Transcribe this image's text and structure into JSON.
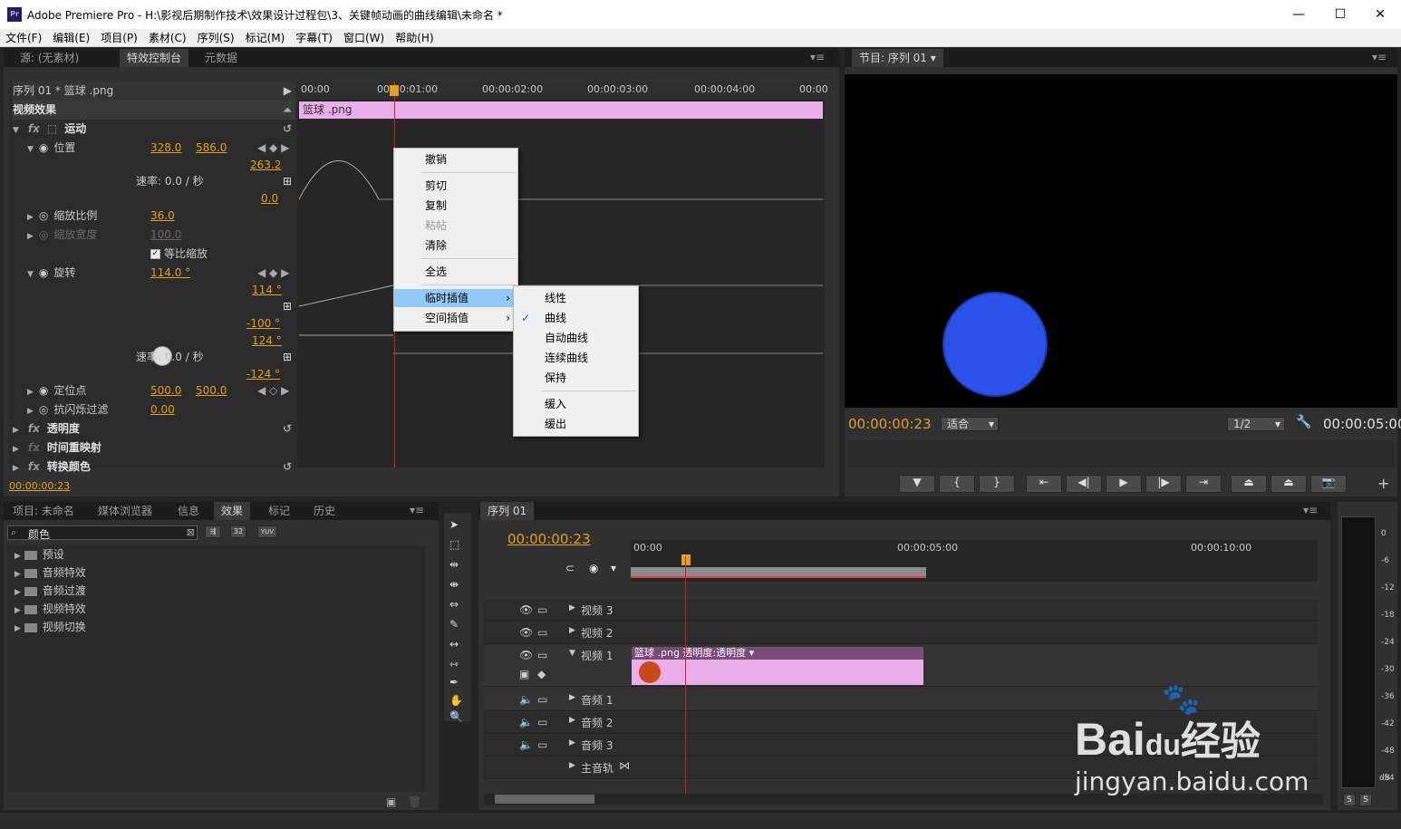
{
  "window": {
    "title": "Adobe Premiere Pro - H:\\影视后期制作技术\\效果设计过程包\\3、关键帧动画的曲线编辑\\未命名 *",
    "logo": "Pr"
  },
  "menu": [
    "文件(F)",
    "编辑(E)",
    "项目(P)",
    "素材(C)",
    "序列(S)",
    "标记(M)",
    "字幕(T)",
    "窗口(W)",
    "帮助(H)"
  ],
  "source_tabs": [
    "源: (无素材)",
    "特效控制台",
    "元数据"
  ],
  "effect_controls": {
    "clip": "序列 01 * 篮球 .png",
    "clip_bar": "篮球 .png",
    "ruler": [
      "00:00",
      "00:00:01:00",
      "00:00:02:00",
      "00:00:03:00",
      "00:00:04:00",
      "00:00"
    ],
    "video_effects": "视频效果",
    "motion": "运动",
    "position": {
      "label": "位置",
      "x": "328.0",
      "y": "586.0"
    },
    "pos_max": "263.2",
    "pos_min": "0.0",
    "speed": "速率: 0.0 / 秒",
    "scale": {
      "label": "缩放比例",
      "value": "36.0"
    },
    "scale_width": {
      "label": "缩放宽度",
      "value": "100.0"
    },
    "uniform_scale": "等比缩放",
    "rotation": {
      "label": "旋转",
      "value": "114.0 °"
    },
    "rot_max": "114 °",
    "rot_min": "-100 °",
    "rot_vmax": "124 °",
    "rot_vmin": "-124 °",
    "rot_speed": "速率: 0.0 / 秒",
    "anchor": {
      "label": "定位点",
      "x": "500.0",
      "y": "500.0"
    },
    "flicker": {
      "label": "抗闪烁过滤",
      "value": "0.00"
    },
    "opacity": "透明度",
    "time_remap": "时间重映射",
    "color_replace": "转换颜色",
    "timecode": "00:00:00:23"
  },
  "context_menu": {
    "items": [
      "撤销",
      "剪切",
      "复制",
      "粘帖",
      "清除",
      "全选",
      "临时插值",
      "空间插值"
    ]
  },
  "submenu": {
    "items": [
      "线性",
      "曲线",
      "自动曲线",
      "连续曲线",
      "保持",
      "缓入",
      "缓出"
    ],
    "checked": "曲线"
  },
  "program": {
    "tab": "节目: 序列 01",
    "timecode": "00:00:00:23",
    "fit": "适合",
    "quality": "1/2",
    "duration": "00:00:05:00",
    "ball_color": "#2a52e8"
  },
  "project_tabs": [
    "项目: 未命名",
    "媒体浏览器",
    "信息",
    "效果",
    "标记",
    "历史"
  ],
  "effects_panel": {
    "search": "颜色",
    "folders": [
      "预设",
      "音频特效",
      "音频过渡",
      "视频特效",
      "视频切换"
    ]
  },
  "sequence": {
    "tab": "序列 01",
    "timecode": "00:00:00:23",
    "ruler": [
      "00:00",
      "00:00:05:00",
      "00:00:10:00"
    ],
    "video_tracks": [
      "视频 3",
      "视频 2",
      "视频 1"
    ],
    "audio_tracks": [
      "音频 1",
      "音频 2",
      "音频 3"
    ],
    "master": "主音轨",
    "clip_label": "篮球 .png",
    "clip_fx": "透明度:透明度"
  },
  "meter_labels": [
    "0",
    "-6",
    "-12",
    "-18",
    "-24",
    "-30",
    "-36",
    "-42",
    "-48",
    "-54",
    "dB"
  ],
  "meter_buttons": [
    "S",
    "S"
  ],
  "watermark": {
    "brand": "Bai",
    "du": "du",
    "cn": "经验",
    "url": "jingyan.baidu.com"
  }
}
